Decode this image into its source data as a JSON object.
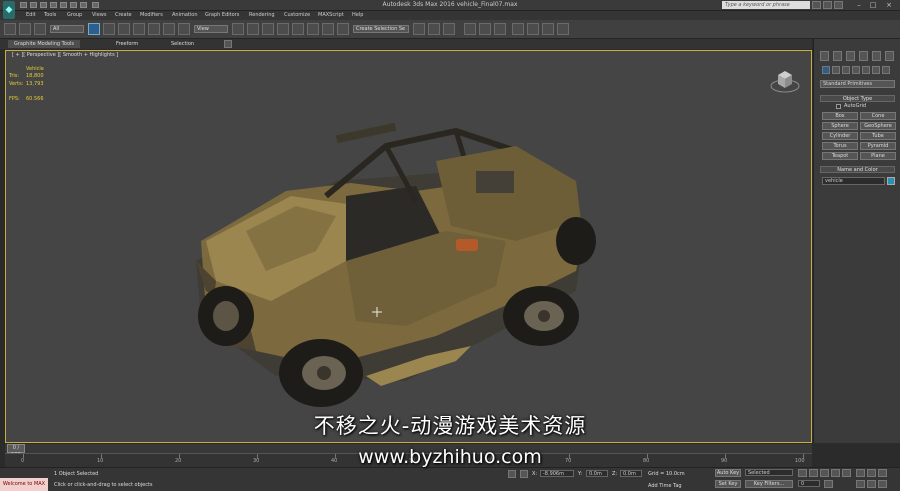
{
  "titlebar": {
    "title": "Autodesk 3ds Max  2016    vehicle_Final07.max",
    "search_placeholder": "Type a keyword or phrase"
  },
  "menu": [
    "Edit",
    "Tools",
    "Group",
    "Views",
    "Create",
    "Modifiers",
    "Animation",
    "Graph Editors",
    "Rendering",
    "Customize",
    "MAXScript",
    "Help"
  ],
  "toolbar": {
    "selection_filter": "All",
    "ref_coord": "View",
    "named_sel": "Create Selection Se"
  },
  "ribbon": {
    "tabs": [
      "Graphite Modeling Tools",
      "Freeform",
      "Selection"
    ]
  },
  "viewport": {
    "label": "[ + ][ Perspective ][ Smooth + Highlights ]",
    "stats": {
      "object": "Vehicle",
      "tris_label": "Tris:",
      "tris": "18,800",
      "verts_label": "Verts:",
      "verts": "13,793",
      "fps_label": "FPS:",
      "fps": "60.566"
    }
  },
  "command_panel": {
    "dropdown": "Standard Primitives",
    "object_type_title": "Object Type",
    "autogrid": "AutoGrid",
    "buttons": [
      "Box",
      "Cone",
      "Sphere",
      "GeoSphere",
      "Cylinder",
      "Tube",
      "Torus",
      "Pyramid",
      "Teapot",
      "Plane"
    ],
    "name_color_title": "Name and Color",
    "name_value": "vehicle"
  },
  "timeline": {
    "frame": "0 / 100",
    "ticks": [
      "0",
      "10",
      "20",
      "30",
      "40",
      "50",
      "60",
      "70",
      "80",
      "90",
      "100"
    ]
  },
  "statusbar": {
    "maxscript": "Welcome to MAX",
    "selected": "1 Object Selected",
    "prompt": "Click or click-and-drag to select objects",
    "x_label": "X:",
    "x_value": "-8.906m",
    "y_label": "Y:",
    "y_value": "0.0m",
    "z_label": "Z:",
    "z_value": "0.0m",
    "grid": "Grid = 10.0cm",
    "add_time_tag": "Add Time Tag",
    "auto_key": "Auto Key",
    "set_key": "Set Key",
    "selected_dropdown": "Selected",
    "key_filters": "Key Filters...",
    "current_frame": "0"
  },
  "watermark": {
    "cn": "不移之火-动漫游戏美术资源",
    "url": "www.byzhihuo.com"
  },
  "colors": {
    "viewport_border": "#c6b040",
    "stats_text": "#e6cf3a",
    "maxscript_bg": "#f2d0d0"
  }
}
